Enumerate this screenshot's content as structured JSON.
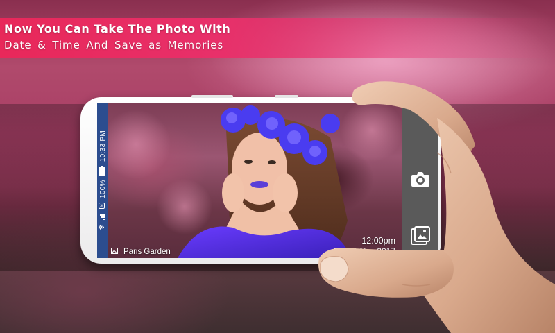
{
  "banner": {
    "line1": "Now You Can Take The Photo With",
    "line2": "Date & Time And Save as Memories"
  },
  "status_bar": {
    "time": "10:33 PM",
    "battery": "100%"
  },
  "camera_overlay": {
    "location": "Paris Garden",
    "time": "12:00pm",
    "date": "Sat-21 Nov 2017"
  },
  "controls": {
    "camera_icon": "camera-icon",
    "gallery_icon": "gallery-icon"
  },
  "colors": {
    "banner": "#e8285a",
    "status_bar": "#2c4d8f",
    "control_panel": "#5a5a5a",
    "background": "#a93e65"
  }
}
